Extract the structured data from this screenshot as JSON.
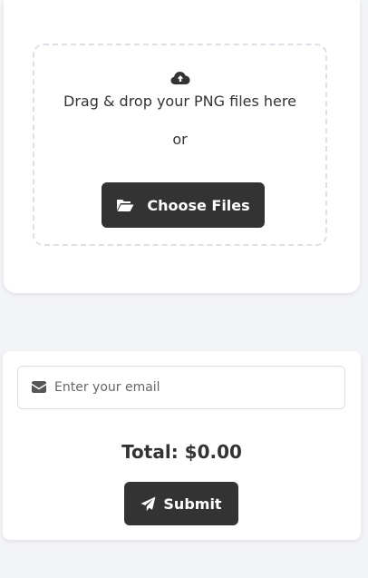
{
  "upload": {
    "icon": "cloud-upload-icon",
    "drop_text": "Drag & drop your PNG files here",
    "or_text": "or",
    "choose_button": {
      "icon": "folder-open-icon",
      "label": "Choose Files"
    }
  },
  "order": {
    "email": {
      "icon": "envelope-icon",
      "placeholder": "Enter your email",
      "value": ""
    },
    "total": "Total: $0.00",
    "submit_button": {
      "icon": "paper-plane-icon",
      "label": "Submit"
    }
  },
  "colors": {
    "page_background": "#f3f4f7",
    "card_background": "#ffffff",
    "button_background": "#333333",
    "button_text": "#ffffff",
    "text": "#333333",
    "dropzone_border": "#dde0e6"
  }
}
